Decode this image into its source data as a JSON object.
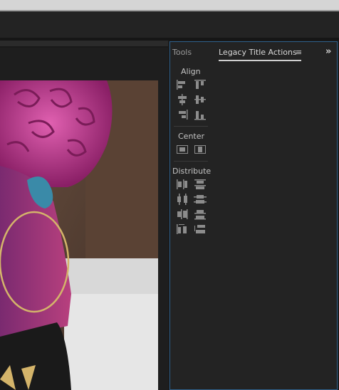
{
  "panel": {
    "tabs": [
      {
        "label": "Tools"
      },
      {
        "label": "Legacy Title Actions"
      }
    ],
    "menu_glyph": "≡",
    "expand_glyph": "»"
  },
  "sections": {
    "align": {
      "label": "Align",
      "icons": [
        "align-left-icon",
        "align-top-icon",
        "align-horizontal-center-icon",
        "align-vertical-center-icon",
        "align-right-icon",
        "align-bottom-icon"
      ]
    },
    "center": {
      "label": "Center",
      "icons": [
        "center-vertical-icon",
        "center-horizontal-icon"
      ]
    },
    "distribute": {
      "label": "Distribute",
      "icons": [
        "distribute-left-icon",
        "distribute-top-icon",
        "distribute-horizontal-center-icon",
        "distribute-vertical-center-icon",
        "distribute-right-icon",
        "distribute-bottom-icon",
        "distribute-horizontal-spacing-icon",
        "distribute-vertical-spacing-icon"
      ]
    }
  },
  "colors": {
    "panel_border": "#2d5f8a",
    "panel_bg": "#232323",
    "hair": "#c0307a",
    "earring": "#d4b46a"
  }
}
